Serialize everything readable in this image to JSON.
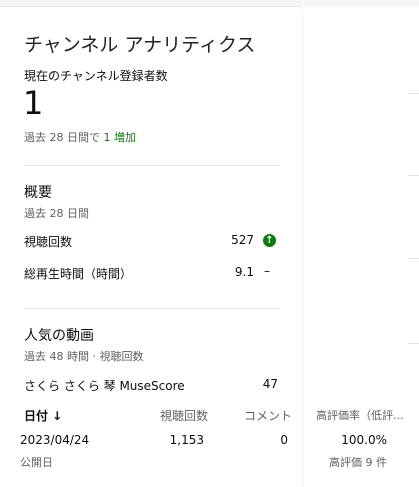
{
  "title": "チャンネル アナリティクス",
  "subscribers": {
    "label": "現在のチャンネル登録者数",
    "value": "1",
    "change_prefix": "過去 28 日間で",
    "change_value": "1 増加"
  },
  "summary": {
    "title": "概要",
    "period": "過去 28 日間",
    "metrics": [
      {
        "label": "視聴回数",
        "value": "527",
        "trend": "up"
      },
      {
        "label": "総再生時間（時間）",
        "value": "9.1",
        "trend": "–"
      }
    ]
  },
  "popular": {
    "title": "人気の動画",
    "period": "過去 48 時間 · 視聴回数",
    "video_title": "さくら さくら 琴 MuseScore",
    "video_views": "47",
    "table": {
      "headers": [
        "日付 ↓",
        "視聴回数",
        "コメント",
        "高評価率（低評..."
      ],
      "row": {
        "date": "2023/04/24",
        "date_sub": "公開日",
        "views": "1,153",
        "comments": "0",
        "like_rate": "100.0%",
        "likes": "高評価 9 件"
      }
    }
  },
  "colors": {
    "accent_green": "#0f7b0f"
  }
}
